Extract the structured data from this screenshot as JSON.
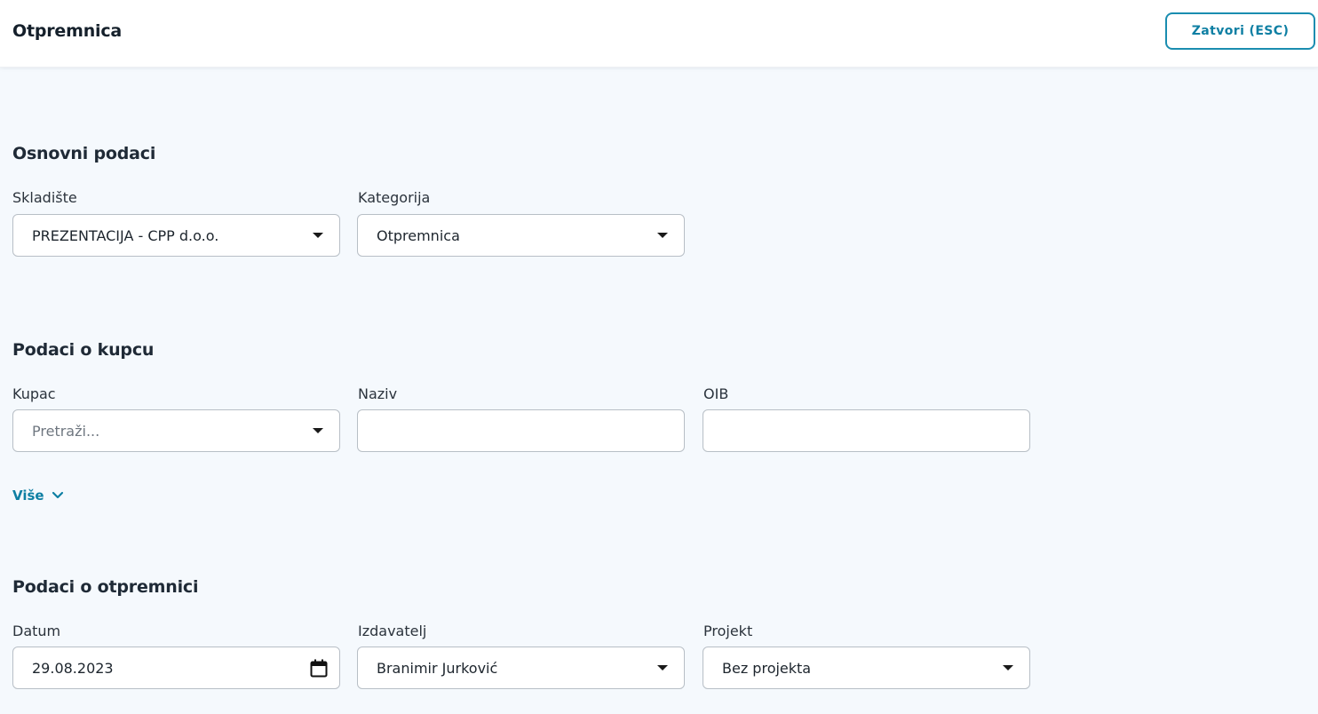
{
  "header": {
    "title": "Otpremnica",
    "close_label": "Zatvori (ESC)"
  },
  "basic": {
    "title": "Osnovni podaci",
    "warehouse_label": "Skladište",
    "warehouse_value": "PREZENTACIJA - CPP d.o.o.",
    "category_label": "Kategorija",
    "category_value": "Otpremnica"
  },
  "customer": {
    "title": "Podaci o kupcu",
    "customer_label": "Kupac",
    "customer_placeholder": "Pretraži...",
    "name_label": "Naziv",
    "name_value": "",
    "oib_label": "OIB",
    "oib_value": "",
    "more_label": "Više"
  },
  "delivery": {
    "title": "Podaci o otpremnici",
    "date_label": "Datum",
    "date_value": "29.08.2023",
    "issuer_label": "Izdavatelj",
    "issuer_value": "Branimir Jurković",
    "project_label": "Projekt",
    "project_value": "Bez projekta"
  },
  "icons": {
    "dropdown": "caret-down-icon",
    "calendar": "calendar-icon",
    "more": "chevron-down-icon"
  },
  "colors": {
    "accent": "#0e7fa3",
    "background": "#f5f9fd",
    "border": "#b8bfc6"
  }
}
